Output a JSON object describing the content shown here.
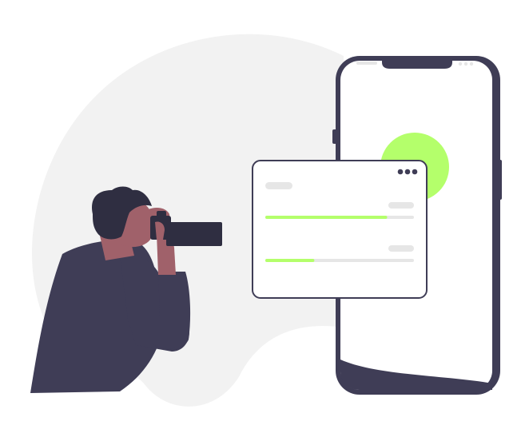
{
  "colors": {
    "background_blob": "#f2f2f2",
    "phone_frame": "#3f3d56",
    "phone_screen": "#ffffff",
    "accent": "#b4ff6b",
    "card_border": "#3f3d56",
    "placeholder_bar": "#e6e6e6",
    "skin": "#a0616a",
    "hair": "#2f2e41",
    "clothing": "#3f3d56",
    "camera": "#2f2e41"
  },
  "progress_bars": [
    {
      "fill_fraction": 0.82
    },
    {
      "fill_fraction": 0.33
    }
  ],
  "card_menu_icon": "three-dots-icon"
}
